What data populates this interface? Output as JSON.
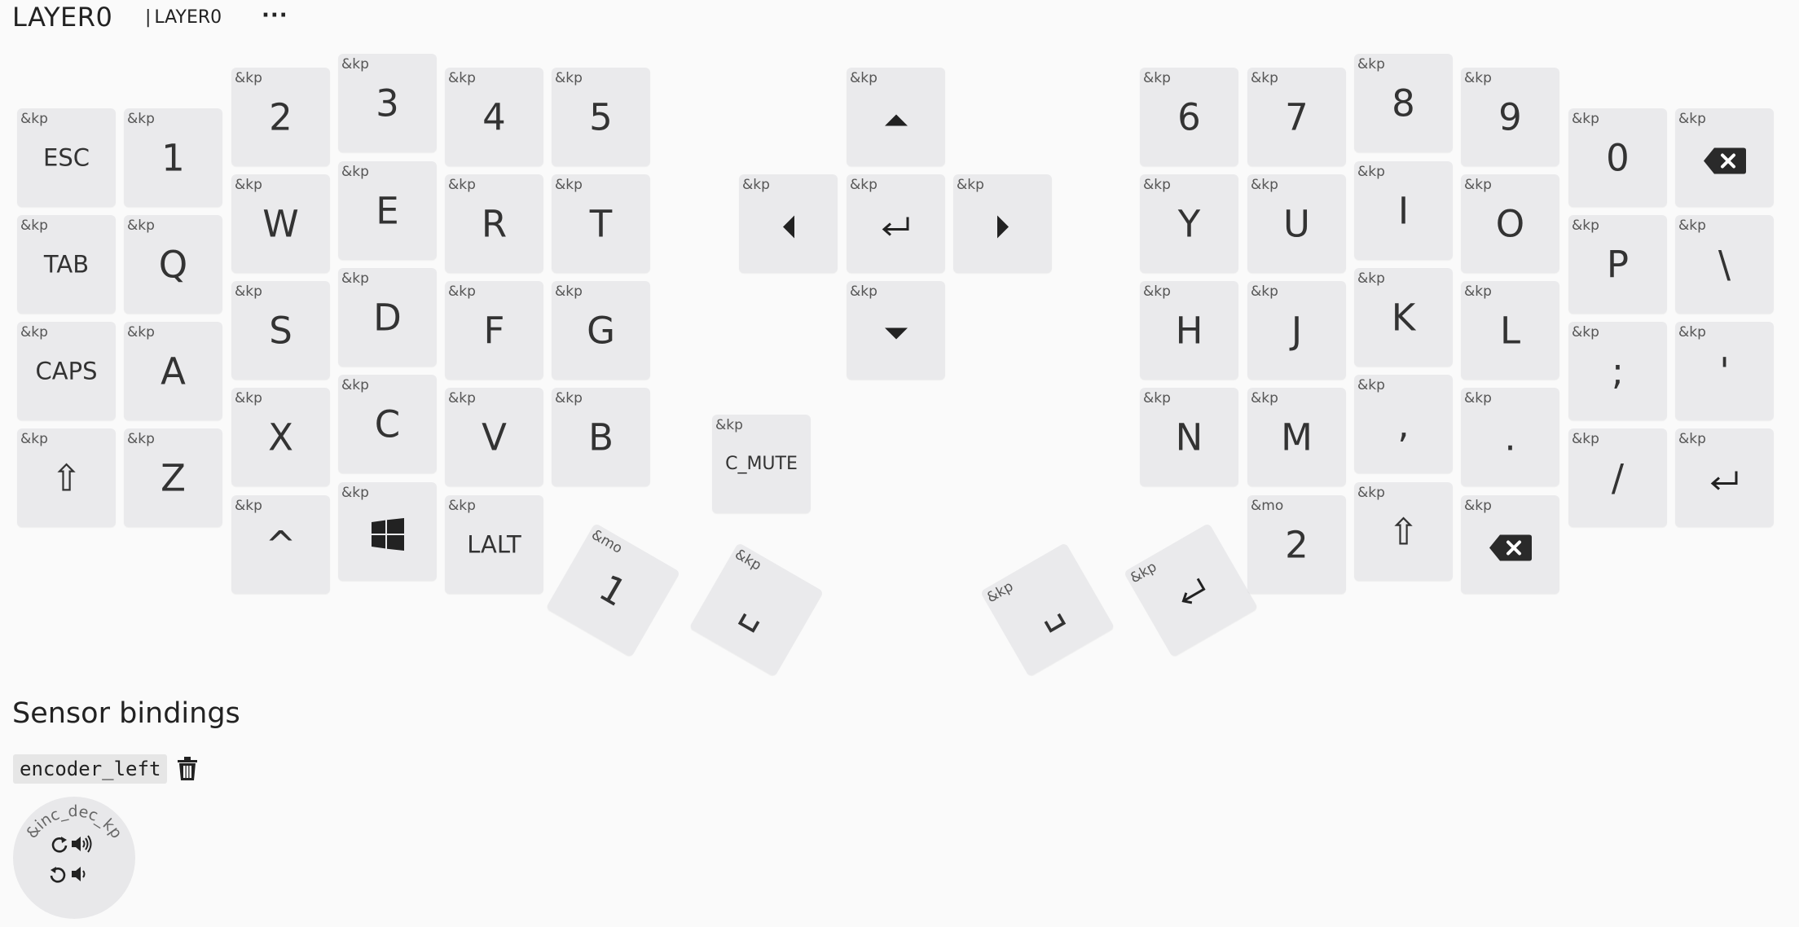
{
  "header": {
    "title": "LAYER0",
    "tab_label": "LAYER0",
    "menu_label": "···"
  },
  "colors": {
    "background": "#fafafa",
    "key": "#eaeaec",
    "text": "#333333"
  },
  "keys": [
    {
      "b": "&kp",
      "l": "ESC"
    },
    {
      "b": "&kp",
      "l": "1"
    },
    {
      "b": "&kp",
      "l": "2"
    },
    {
      "b": "&kp",
      "l": "3"
    },
    {
      "b": "&kp",
      "l": "4"
    },
    {
      "b": "&kp",
      "l": "5"
    },
    {
      "b": "&kp",
      "l": "TAB"
    },
    {
      "b": "&kp",
      "l": "Q"
    },
    {
      "b": "&kp",
      "l": "W"
    },
    {
      "b": "&kp",
      "l": "E"
    },
    {
      "b": "&kp",
      "l": "R"
    },
    {
      "b": "&kp",
      "l": "T"
    },
    {
      "b": "&kp",
      "l": "CAPS"
    },
    {
      "b": "&kp",
      "l": "A"
    },
    {
      "b": "&kp",
      "l": "S"
    },
    {
      "b": "&kp",
      "l": "D"
    },
    {
      "b": "&kp",
      "l": "F"
    },
    {
      "b": "&kp",
      "l": "G"
    },
    {
      "b": "&kp",
      "l": "⇧"
    },
    {
      "b": "&kp",
      "l": "Z"
    },
    {
      "b": "&kp",
      "l": "X"
    },
    {
      "b": "&kp",
      "l": "C"
    },
    {
      "b": "&kp",
      "l": "V"
    },
    {
      "b": "&kp",
      "l": "B"
    },
    {
      "b": "&kp",
      "l": "^"
    },
    {
      "b": "&kp",
      "l": "",
      "icon": "windows-icon"
    },
    {
      "b": "&kp",
      "l": "LALT"
    },
    {
      "b": "&mo",
      "l": "1"
    },
    {
      "b": "&kp",
      "l": "␣"
    },
    {
      "b": "&kp",
      "l": "",
      "icon": "arrow-up-icon"
    },
    {
      "b": "&kp",
      "l": "",
      "icon": "arrow-left-icon"
    },
    {
      "b": "&kp",
      "l": "",
      "icon": "return-icon"
    },
    {
      "b": "&kp",
      "l": "",
      "icon": "arrow-right-icon"
    },
    {
      "b": "&kp",
      "l": "",
      "icon": "arrow-down-icon"
    },
    {
      "b": "&kp",
      "l": "C_MUTE"
    },
    {
      "b": "&kp",
      "l": "␣"
    },
    {
      "b": "&kp",
      "l": "",
      "icon": "return-icon"
    },
    {
      "b": "&kp",
      "l": "6"
    },
    {
      "b": "&kp",
      "l": "7"
    },
    {
      "b": "&kp",
      "l": "8"
    },
    {
      "b": "&kp",
      "l": "9"
    },
    {
      "b": "&kp",
      "l": "0"
    },
    {
      "b": "&kp",
      "l": "",
      "icon": "backspace-icon"
    },
    {
      "b": "&kp",
      "l": "Y"
    },
    {
      "b": "&kp",
      "l": "U"
    },
    {
      "b": "&kp",
      "l": "I"
    },
    {
      "b": "&kp",
      "l": "O"
    },
    {
      "b": "&kp",
      "l": "P"
    },
    {
      "b": "&kp",
      "l": "\\"
    },
    {
      "b": "&kp",
      "l": "H"
    },
    {
      "b": "&kp",
      "l": "J"
    },
    {
      "b": "&kp",
      "l": "K"
    },
    {
      "b": "&kp",
      "l": "L"
    },
    {
      "b": "&kp",
      "l": ";"
    },
    {
      "b": "&kp",
      "l": "'"
    },
    {
      "b": "&kp",
      "l": "N"
    },
    {
      "b": "&kp",
      "l": "M"
    },
    {
      "b": "&kp",
      "l": ","
    },
    {
      "b": "&kp",
      "l": "."
    },
    {
      "b": "&kp",
      "l": "/"
    },
    {
      "b": "&kp",
      "l": "",
      "icon": "return-icon"
    },
    {
      "b": "&mo",
      "l": "2"
    },
    {
      "b": "&kp",
      "l": "⇧"
    },
    {
      "b": "&kp",
      "l": "",
      "icon": "backspace-icon"
    }
  ],
  "sensors": {
    "title": "Sensor bindings",
    "name": "encoder_left",
    "behavior": "&inc_dec_kp",
    "cw_icons": [
      "rotate-cw-icon",
      "volume-up-icon"
    ],
    "ccw_icons": [
      "rotate-ccw-icon",
      "volume-down-icon"
    ]
  }
}
